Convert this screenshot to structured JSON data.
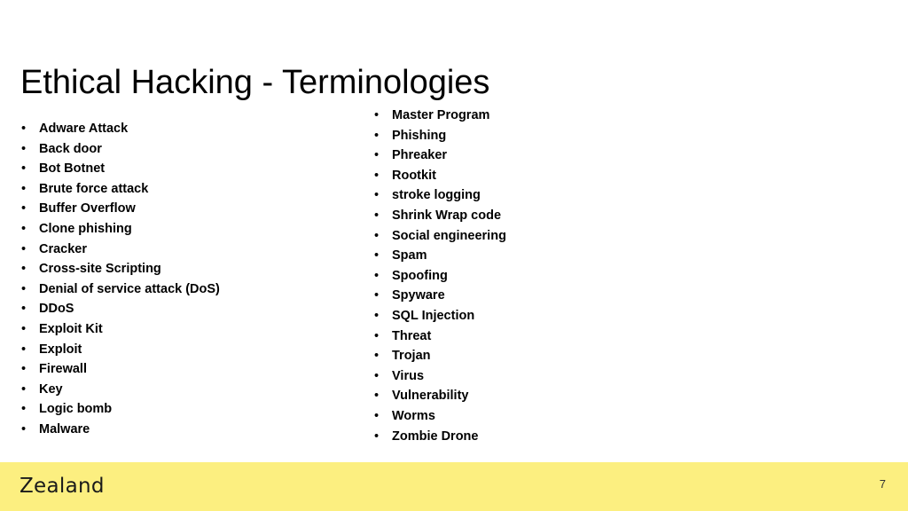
{
  "slide": {
    "title": "Ethical Hacking - Terminologies",
    "background_color": "#ffffff",
    "page_number": "7"
  },
  "bullet_marker": "•",
  "columns": {
    "left": [
      {
        "label": "Adware Attack"
      },
      {
        "label": "Back door"
      },
      {
        "label": "Bot Botnet"
      },
      {
        "label": "Brute force attack"
      },
      {
        "label": "Buffer Overflow"
      },
      {
        "label": "Clone phishing"
      },
      {
        "label": "Cracker"
      },
      {
        "label": "Cross-site Scripting"
      },
      {
        "label": "Denial of service attack (DoS)"
      },
      {
        "label": "DDoS"
      },
      {
        "label": "Exploit Kit"
      },
      {
        "label": "Exploit"
      },
      {
        "label": "Firewall"
      },
      {
        "label": "Key"
      },
      {
        "label": "Logic bomb"
      },
      {
        "label": "Malware"
      }
    ],
    "right": [
      {
        "label": "Master Program"
      },
      {
        "label": "Phishing"
      },
      {
        "label": "Phreaker"
      },
      {
        "label": "Rootkit"
      },
      {
        "label": "stroke logging"
      },
      {
        "label": "Shrink Wrap code"
      },
      {
        "label": "Social engineering"
      },
      {
        "label": "Spam"
      },
      {
        "label": "Spoofing"
      },
      {
        "label": "Spyware"
      },
      {
        "label": "SQL Injection"
      },
      {
        "label": "Threat"
      },
      {
        "label": "Trojan"
      },
      {
        "label": "Virus"
      },
      {
        "label": "Vulnerability"
      },
      {
        "label": "Worms"
      },
      {
        "label": "Zombie Drone"
      }
    ]
  },
  "footer": {
    "brand": "Zealand",
    "band_color": "#fcef80",
    "page_number": "7"
  }
}
